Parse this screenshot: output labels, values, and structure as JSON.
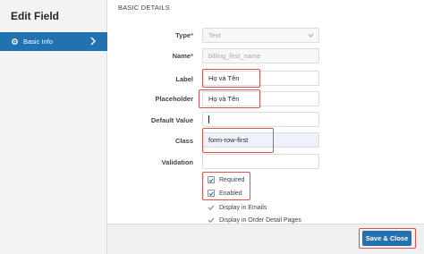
{
  "dialog": {
    "title": "Edit Field"
  },
  "sidebar": {
    "items": [
      {
        "label": "Basic Info",
        "icon": "gear-icon"
      }
    ]
  },
  "section": {
    "title": "BASIC DETAILS"
  },
  "form": {
    "type": {
      "label": "Type",
      "required_mark": "*",
      "value": "Text"
    },
    "name": {
      "label": "Name",
      "required_mark": "*",
      "value": "billing_first_name"
    },
    "label": {
      "label": "Label",
      "value": "Họ và Tên"
    },
    "placeholder": {
      "label": "Placeholder",
      "value": "Họ và Tên"
    },
    "default_value": {
      "label": "Default Value",
      "value": ""
    },
    "class": {
      "label": "Class",
      "value": "form-row-first"
    },
    "validation": {
      "label": "Validation",
      "value": ""
    }
  },
  "options": [
    {
      "label": "Required",
      "checked": true
    },
    {
      "label": "Enabled",
      "checked": true
    },
    {
      "label": "Display in Emails",
      "checked": true
    },
    {
      "label": "Display in Order Detail Pages",
      "checked": true
    }
  ],
  "footer": {
    "save_label": "Save & Close"
  },
  "colors": {
    "accent": "#2271b1",
    "highlight": "#d9534f",
    "required": "#d63638"
  }
}
